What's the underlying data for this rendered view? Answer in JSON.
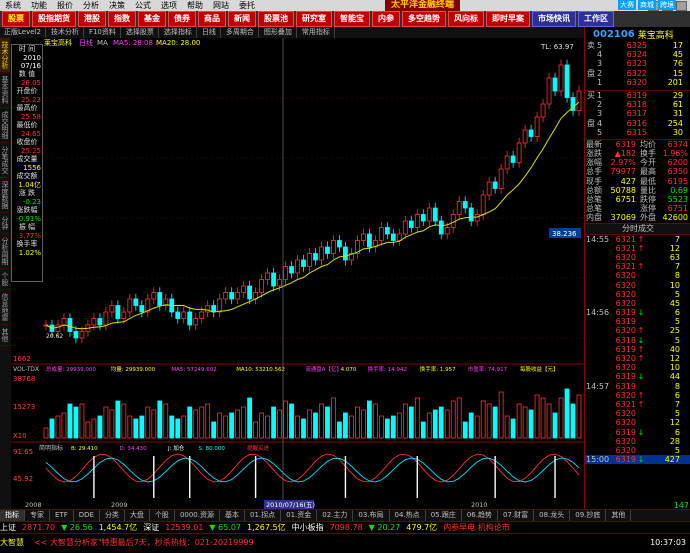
{
  "menubar": {
    "items": [
      "系统",
      "功能",
      "报价",
      "分析",
      "决策",
      "公式",
      "选项",
      "帮助",
      "网站",
      "委托"
    ],
    "brand": "太平洋金融终端",
    "right_badges": [
      "大赛",
      "商城",
      "跨境"
    ]
  },
  "toolbar": {
    "buttons": [
      "股票",
      "股指期货",
      "港股",
      "指数",
      "基金",
      "债券",
      "商品",
      "新闻",
      "股票池",
      "研究室",
      "智能宝",
      "内参",
      "多空趋势",
      "风向标",
      "即时早案",
      "市场快讯",
      "工作区"
    ]
  },
  "subbar": {
    "tabs": [
      "正版Level2",
      "技术分析",
      "F10资料",
      "选择股票",
      "选择指标",
      "日线",
      "多周期合",
      "图形叠加",
      "常用指标"
    ]
  },
  "leftstrip": [
    "技术分析",
    "基本资料",
    "成交明细",
    "分笔成交",
    "深度数据",
    "分钟",
    "分析周期",
    "个股",
    "信息地雷",
    "其他"
  ],
  "infopanel": {
    "title": "莱宝高科",
    "rows": [
      {
        "label": "时 间",
        "value": "2010",
        "value2": "07/16"
      },
      {
        "label": "数 值",
        "value": "26.05"
      },
      {
        "label": "开盘价",
        "value": "25.23"
      },
      {
        "label": "最高价",
        "value": "25.58"
      },
      {
        "label": "最低价",
        "value": "24.65"
      },
      {
        "label": "收盘价",
        "value": "25.25"
      },
      {
        "label": "成交量",
        "value": "1556"
      },
      {
        "label": "成交额",
        "value": "1.04亿"
      },
      {
        "label": "涨 跌",
        "value": "-0.23"
      },
      {
        "label": "涨跌幅",
        "value": "-0.91%"
      },
      {
        "label": "振 幅",
        "value": "3.77%"
      },
      {
        "label": "换手率",
        "value": "1.02%"
      }
    ]
  },
  "chart": {
    "header_name": "莱宝高科",
    "header_period": "日线",
    "header_indicator": "MA",
    "header_values": [
      "MA5: 28.08",
      "MA20: 28.00"
    ],
    "price_labels": {
      "high": "TL: 63.97",
      "last": "38.236",
      "low": "20.62",
      "axis_bottom": "1662"
    },
    "volume_header": "VOL-TDX",
    "volume_stats": [
      "总成量: 29939.000",
      "均量: 29939.000",
      "MA5: 57249.602",
      "MA10: 53210.562",
      "流通盘A【亿】",
      "4.070",
      "换手率: 14.942",
      "换手率: 1.957",
      "市盈率: 74.917",
      "每股收益【元】"
    ],
    "volume_axis": [
      "38768",
      "15273",
      "X10"
    ],
    "macd_header": "简明指标",
    "macd_values": [
      "B: 29.410",
      "D: 34.430",
      "J: 加仓",
      "S: 80.000",
      "提醒买进"
    ],
    "macd_axis": [
      "91.65",
      "45.92"
    ],
    "date_marker": "2010/07/16(五)",
    "date_axis": [
      "2008",
      "2009",
      "2010"
    ],
    "chart_data": {
      "type": "candlestick",
      "close": [
        22,
        21,
        22,
        23,
        21,
        20,
        21,
        22,
        23,
        22,
        24,
        25,
        23,
        24,
        26,
        25,
        24,
        26,
        27,
        25,
        26,
        24,
        23,
        24,
        22,
        23,
        24,
        25,
        24,
        26,
        27,
        26,
        27,
        28,
        26,
        27,
        29,
        30,
        28,
        29,
        31,
        30,
        32,
        31,
        33,
        32,
        34,
        33,
        35,
        34,
        32,
        33,
        35,
        36,
        34,
        35,
        37,
        36,
        35,
        36,
        38,
        37,
        39,
        38,
        40,
        38,
        36,
        37,
        39,
        41,
        40,
        38,
        39,
        42,
        44,
        43,
        46,
        48,
        47,
        50,
        52,
        51,
        54,
        56,
        60,
        58,
        62,
        57,
        55,
        58
      ],
      "ylim": [
        20,
        64
      ]
    }
  },
  "right": {
    "code": "002106",
    "name": "莱宝高科",
    "sell": [
      {
        "label": "卖",
        "lvl": "5",
        "price": "6325",
        "vol": "17"
      },
      {
        "label": "",
        "lvl": "4",
        "price": "6324",
        "vol": "45"
      },
      {
        "label": "",
        "lvl": "3",
        "price": "6323",
        "vol": "76"
      },
      {
        "label": "盘",
        "lvl": "2",
        "price": "6322",
        "vol": "15"
      },
      {
        "label": "",
        "lvl": "1",
        "price": "6320",
        "vol": "201"
      }
    ],
    "buy": [
      {
        "label": "买",
        "lvl": "1",
        "price": "6319",
        "vol": "29"
      },
      {
        "label": "",
        "lvl": "2",
        "price": "6318",
        "vol": "61"
      },
      {
        "label": "",
        "lvl": "3",
        "price": "6317",
        "vol": "31"
      },
      {
        "label": "盘",
        "lvl": "4",
        "price": "6316",
        "vol": "254"
      },
      {
        "label": "",
        "lvl": "5",
        "price": "6315",
        "vol": "30"
      }
    ],
    "stats": [
      {
        "k1": "最新",
        "v1": "6319",
        "k2": "均价",
        "v2": "6374"
      },
      {
        "k1": "涨跌",
        "v1": "▲182",
        "k2": "换手",
        "v2": "1.96%"
      },
      {
        "k1": "涨幅",
        "v1": "2.97%",
        "k2": "今开",
        "v2": "6200"
      },
      {
        "k1": "总手",
        "v1": "79977",
        "k2": "最高",
        "v2": "6350"
      },
      {
        "k1": "现手",
        "v1": "427",
        "k2": "最低",
        "v2": "6195"
      },
      {
        "k1": "总额",
        "v1": "50788",
        "k2": "量比",
        "v2": "0.69"
      },
      {
        "k1": "总笔",
        "v1": "6751",
        "k2": "跌停",
        "v2": "5523"
      },
      {
        "k1": "总笔",
        "v1": "",
        "k2": "涨停",
        "v2": "6751"
      },
      {
        "k1": "内盘",
        "v1": "37069",
        "k2": "外盘",
        "v2": "42600"
      }
    ],
    "trade_header": "分时成交",
    "trades": [
      {
        "t": "14:55",
        "p": "6321",
        "d": "↑",
        "v": "7"
      },
      {
        "t": "",
        "p": "6321",
        "d": "↑",
        "v": "12"
      },
      {
        "t": "",
        "p": "6320",
        "d": "",
        "v": "63"
      },
      {
        "t": "",
        "p": "6321",
        "d": "↑",
        "v": "7"
      },
      {
        "t": "",
        "p": "6320",
        "d": "",
        "v": "8"
      },
      {
        "t": "",
        "p": "6320",
        "d": "",
        "v": "10"
      },
      {
        "t": "",
        "p": "6320",
        "d": "",
        "v": "5"
      },
      {
        "t": "",
        "p": "6320",
        "d": "",
        "v": "45"
      },
      {
        "t": "14:56",
        "p": "6319",
        "d": "↓",
        "v": "6"
      },
      {
        "t": "",
        "p": "6319",
        "d": "",
        "v": "5"
      },
      {
        "t": "",
        "p": "6320",
        "d": "↑",
        "v": "25"
      },
      {
        "t": "",
        "p": "6318",
        "d": "↓",
        "v": "5"
      },
      {
        "t": "",
        "p": "6319",
        "d": "↑",
        "v": "40"
      },
      {
        "t": "",
        "p": "6320",
        "d": "↑",
        "v": "12"
      },
      {
        "t": "",
        "p": "6320",
        "d": "",
        "v": "10"
      },
      {
        "t": "",
        "p": "6319",
        "d": "↓",
        "v": "44"
      },
      {
        "t": "14:57",
        "p": "6319",
        "d": "",
        "v": "8"
      },
      {
        "t": "",
        "p": "6320",
        "d": "↑",
        "v": "6"
      },
      {
        "t": "",
        "p": "6321",
        "d": "↑",
        "v": "7"
      },
      {
        "t": "",
        "p": "6320",
        "d": "",
        "v": "5"
      },
      {
        "t": "",
        "p": "6320",
        "d": "",
        "v": "12"
      },
      {
        "t": "",
        "p": "6319",
        "d": "↓",
        "v": "6"
      },
      {
        "t": "",
        "p": "6320",
        "d": "",
        "v": "28"
      },
      {
        "t": "",
        "p": "6320",
        "d": "",
        "v": "5"
      },
      {
        "t": "15:00",
        "p": "6319",
        "d": "↓",
        "v": "427"
      }
    ],
    "last_trade_extra": "147"
  },
  "bottomtabs": [
    "指标",
    "专家",
    "ETF",
    "DDE",
    "分类",
    "大盘",
    "个股",
    "0000.资源",
    "基本",
    "01.拐点",
    "01.资金",
    "02.主力",
    "03.布局",
    "04.热点",
    "05.跟庄",
    "06.趋势",
    "07.财富",
    "08.龙头",
    "09.抄底",
    "其他"
  ],
  "statusbar": {
    "items": [
      {
        "text": "上证",
        "cls": "white"
      },
      {
        "text": "2871.70",
        "cls": "red"
      },
      {
        "text": "▼ 26.56",
        "cls": "green"
      },
      {
        "text": "1,454.7亿",
        "cls": "yellow"
      },
      {
        "text": "深证",
        "cls": "white"
      },
      {
        "text": "12539.01",
        "cls": "red"
      },
      {
        "text": "▼ 65.07",
        "cls": "green"
      },
      {
        "text": "1,267.5亿",
        "cls": "yellow"
      },
      {
        "text": "中小板指",
        "cls": "white"
      },
      {
        "text": "7098.78",
        "cls": "red"
      },
      {
        "text": "▼ 20.27",
        "cls": "green"
      },
      {
        "text": "479.7亿",
        "cls": "yellow"
      },
      {
        "text": "内参早电 机构论市",
        "cls": "red"
      }
    ]
  },
  "tickerbar": {
    "items": [
      {
        "text": "大智慧",
        "cls": "yellow"
      },
      {
        "text": "<< 大智慧分析家\"特惠最后7天，秒杀热线：021-20219999",
        "cls": "red"
      },
      {
        "text": "10:37:03",
        "cls": "white"
      }
    ]
  }
}
